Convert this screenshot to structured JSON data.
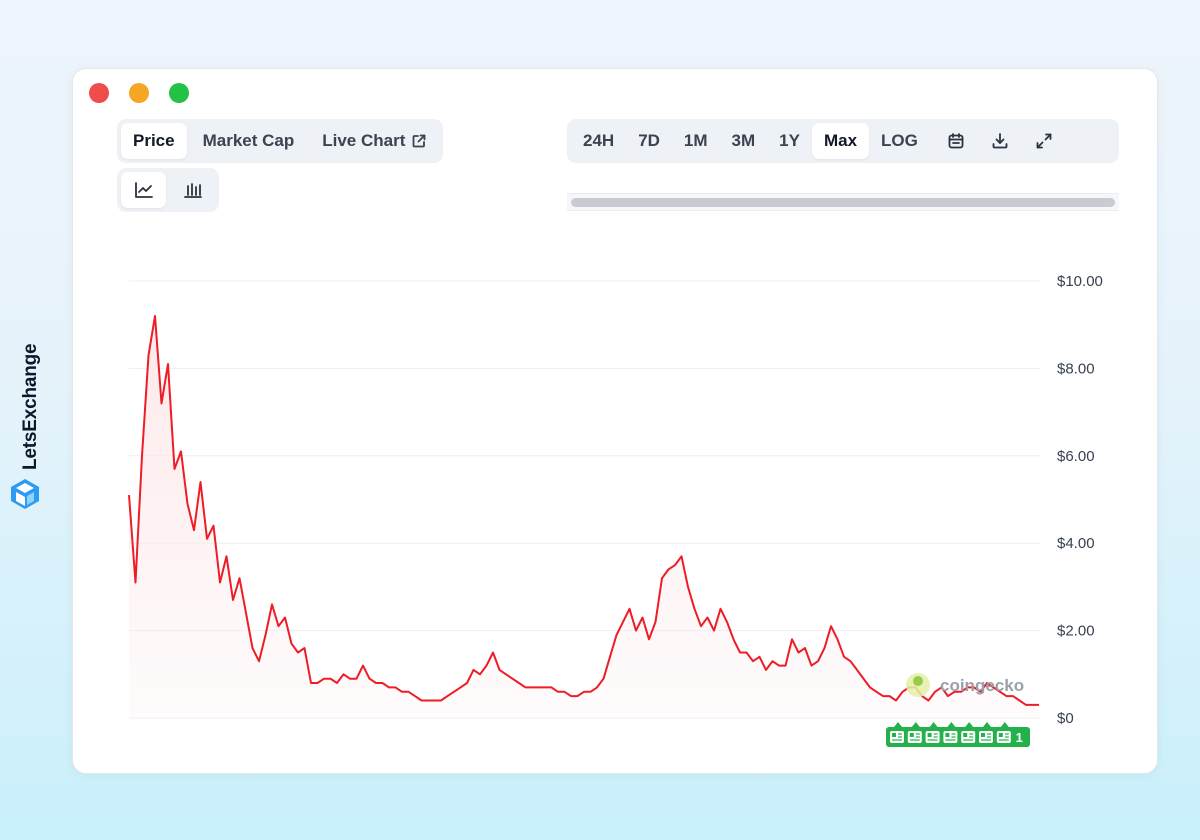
{
  "brand": {
    "name": "LetsExchange",
    "logo": "letsexchange-logo-icon"
  },
  "window": {
    "controls": [
      "close-dot",
      "minimize-dot",
      "maximize-dot"
    ]
  },
  "tabs": [
    {
      "label": "Price",
      "active": true
    },
    {
      "label": "Market Cap",
      "active": false
    },
    {
      "label": "Live Chart",
      "active": false,
      "icon": "external-link-icon"
    }
  ],
  "chart_types": [
    {
      "icon": "line-chart-icon",
      "active": true
    },
    {
      "icon": "candlestick-icon",
      "active": false
    }
  ],
  "ranges": [
    {
      "label": "24H",
      "active": false
    },
    {
      "label": "7D",
      "active": false
    },
    {
      "label": "1M",
      "active": false
    },
    {
      "label": "3M",
      "active": false
    },
    {
      "label": "1Y",
      "active": false
    },
    {
      "label": "Max",
      "active": true
    },
    {
      "label": "LOG",
      "active": false
    }
  ],
  "toolbar_icons": [
    "calendar-icon",
    "download-icon",
    "fullscreen-icon"
  ],
  "watermark": "coingecko",
  "news_badge": {
    "count": "1",
    "icon": "news-icon",
    "icons_shown": 7
  },
  "colors": {
    "line": "#ee1c25",
    "fill": "#fde8e9",
    "news": "#24b04a",
    "grid": "#eceff3"
  },
  "chart_data": {
    "type": "area",
    "title": "",
    "xlabel": "",
    "ylabel": "",
    "y_axis_position": "right",
    "ylim": [
      0,
      10
    ],
    "yticks": [
      {
        "value": 0,
        "label": "$0"
      },
      {
        "value": 2,
        "label": "$2.00"
      },
      {
        "value": 4,
        "label": "$4.00"
      },
      {
        "value": 6,
        "label": "$6.00"
      },
      {
        "value": 8,
        "label": "$8.00"
      },
      {
        "value": 10,
        "label": "$10.00"
      }
    ],
    "grid": true,
    "series": [
      {
        "values": [
          5.1,
          3.1,
          6.0,
          8.3,
          9.2,
          7.2,
          8.1,
          5.7,
          6.1,
          4.9,
          4.3,
          5.4,
          4.1,
          4.4,
          3.1,
          3.7,
          2.7,
          3.2,
          2.4,
          1.6,
          1.3,
          1.9,
          2.6,
          2.1,
          2.3,
          1.7,
          1.5,
          1.6,
          0.8,
          0.8,
          0.9,
          0.9,
          0.8,
          1.0,
          0.9,
          0.9,
          1.2,
          0.9,
          0.8,
          0.8,
          0.7,
          0.7,
          0.6,
          0.6,
          0.5,
          0.4,
          0.4,
          0.4,
          0.4,
          0.5,
          0.6,
          0.7,
          0.8,
          1.1,
          1.0,
          1.2,
          1.5,
          1.1,
          1.0,
          0.9,
          0.8,
          0.7,
          0.7,
          0.7,
          0.7,
          0.7,
          0.6,
          0.6,
          0.5,
          0.5,
          0.6,
          0.6,
          0.7,
          0.9,
          1.4,
          1.9,
          2.2,
          2.5,
          2.0,
          2.3,
          1.8,
          2.2,
          3.2,
          3.4,
          3.5,
          3.7,
          3.0,
          2.5,
          2.1,
          2.3,
          2.0,
          2.5,
          2.2,
          1.8,
          1.5,
          1.5,
          1.3,
          1.4,
          1.1,
          1.3,
          1.2,
          1.2,
          1.8,
          1.5,
          1.6,
          1.2,
          1.3,
          1.6,
          2.1,
          1.8,
          1.4,
          1.3,
          1.1,
          0.9,
          0.7,
          0.6,
          0.5,
          0.5,
          0.4,
          0.6,
          0.7,
          0.7,
          0.5,
          0.4,
          0.6,
          0.7,
          0.5,
          0.6,
          0.6,
          0.7,
          0.7,
          0.6,
          0.8,
          0.7,
          0.6,
          0.5,
          0.5,
          0.4,
          0.3,
          0.3,
          0.3
        ]
      }
    ]
  }
}
